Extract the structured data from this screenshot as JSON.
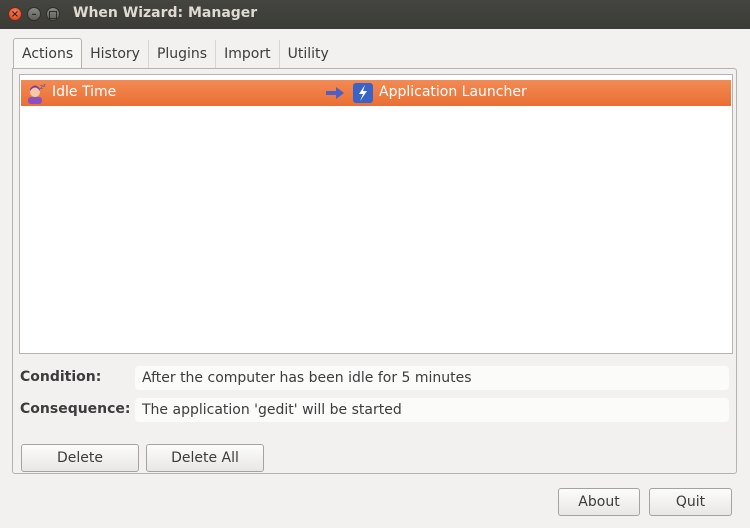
{
  "window": {
    "title": "When Wizard: Manager",
    "close_glyph": "×",
    "minimize_glyph": "–"
  },
  "tabs": [
    {
      "label": "Actions",
      "active": true
    },
    {
      "label": "History"
    },
    {
      "label": "Plugins"
    },
    {
      "label": "Import"
    },
    {
      "label": "Utility"
    }
  ],
  "actions_list": {
    "rows": [
      {
        "condition": "Idle Time",
        "condition_icon": "idle-user-icon",
        "arrow_icon": "right-arrow-icon",
        "consequence": "Application Launcher",
        "consequence_icon": "launcher-icon",
        "selected": true
      }
    ]
  },
  "details": {
    "condition_label": "Condition:",
    "condition_value": "After the computer has been idle for 5 minutes",
    "consequence_label": "Consequence:",
    "consequence_value": "The application 'gedit' will be started"
  },
  "buttons": {
    "delete": "Delete",
    "delete_all": "Delete All",
    "about": "About",
    "quit": "Quit"
  },
  "colors": {
    "selection": "#ee7a42",
    "titlebar": "#3f3f3b",
    "arrow": "#5566cc",
    "launcher": "#3366cc"
  }
}
